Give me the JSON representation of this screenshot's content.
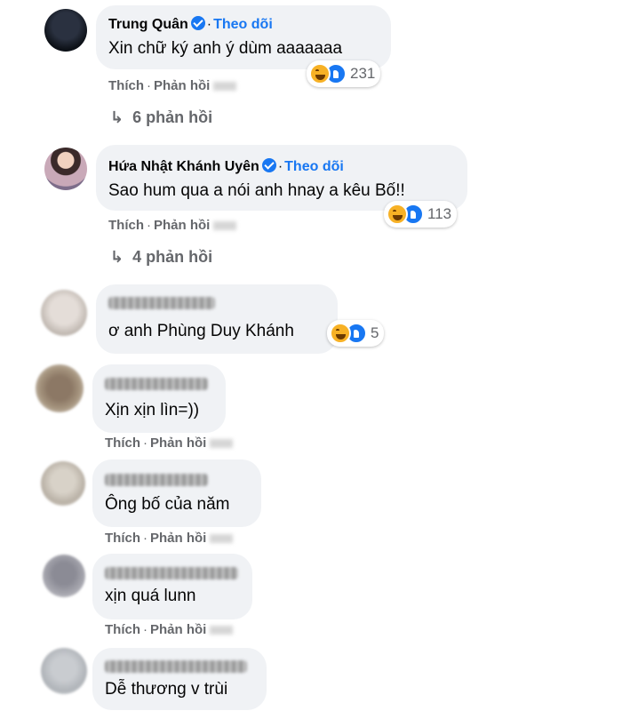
{
  "comments": [
    {
      "name": "Trung Quân",
      "verified": true,
      "follow": "Theo dõi",
      "text": "Xin chữ ký anh ý dùm aaaaaaa",
      "reaction_count": "231",
      "action_like": "Thích",
      "action_reply": "Phản hồi",
      "replies": "6 phản hồi"
    },
    {
      "name": "Hứa Nhật Khánh Uyên",
      "verified": true,
      "follow": "Theo dõi",
      "text": "Sao hum qua a nói anh hnay a kêu Bố!!",
      "reaction_count": "113",
      "action_like": "Thích",
      "action_reply": "Phản hồi",
      "replies": "4 phản hồi"
    },
    {
      "name_blurred": true,
      "text": "ơ anh Phùng Duy Khánh",
      "reaction_count": "5"
    },
    {
      "name_blurred": true,
      "text": "Xịn xịn lìn=))",
      "action_like": "Thích",
      "action_reply": "Phản hồi"
    },
    {
      "name_blurred": true,
      "text": "Ông bố của năm",
      "action_like": "Thích",
      "action_reply": "Phản hồi"
    },
    {
      "name_blurred": true,
      "text": "xịn quá lunn",
      "action_like": "Thích",
      "action_reply": "Phản hồi"
    },
    {
      "name_blurred": true,
      "text": "Dễ thương v trùi"
    }
  ],
  "icons": {
    "reply_arrow": "reply-arrow-icon",
    "verified": "verified-badge-icon",
    "haha": "haha-reaction-icon",
    "like": "like-reaction-icon"
  },
  "colors": {
    "bubble": "#f0f2f5",
    "link_blue": "#1877f2",
    "meta_gray": "#65676b"
  }
}
